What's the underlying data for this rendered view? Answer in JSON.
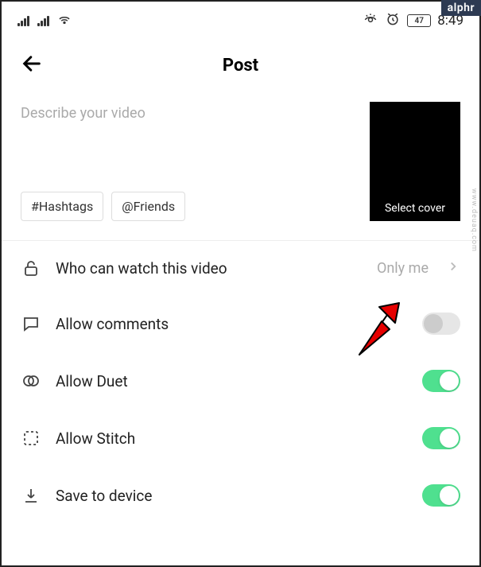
{
  "badge": "alphr",
  "watermark": "www.deuaq.com",
  "status_bar": {
    "battery": "47",
    "time": "8:49"
  },
  "header": {
    "title": "Post"
  },
  "compose": {
    "placeholder": "Describe your video",
    "hashtags_label": "#Hashtags",
    "friends_label": "@Friends",
    "cover_label": "Select cover"
  },
  "settings": {
    "privacy": {
      "label": "Who can watch this video",
      "value": "Only me"
    },
    "comments": {
      "label": "Allow comments",
      "on": false
    },
    "duet": {
      "label": "Allow Duet",
      "on": true
    },
    "stitch": {
      "label": "Allow Stitch",
      "on": true
    },
    "save": {
      "label": "Save to device",
      "on": true
    }
  }
}
